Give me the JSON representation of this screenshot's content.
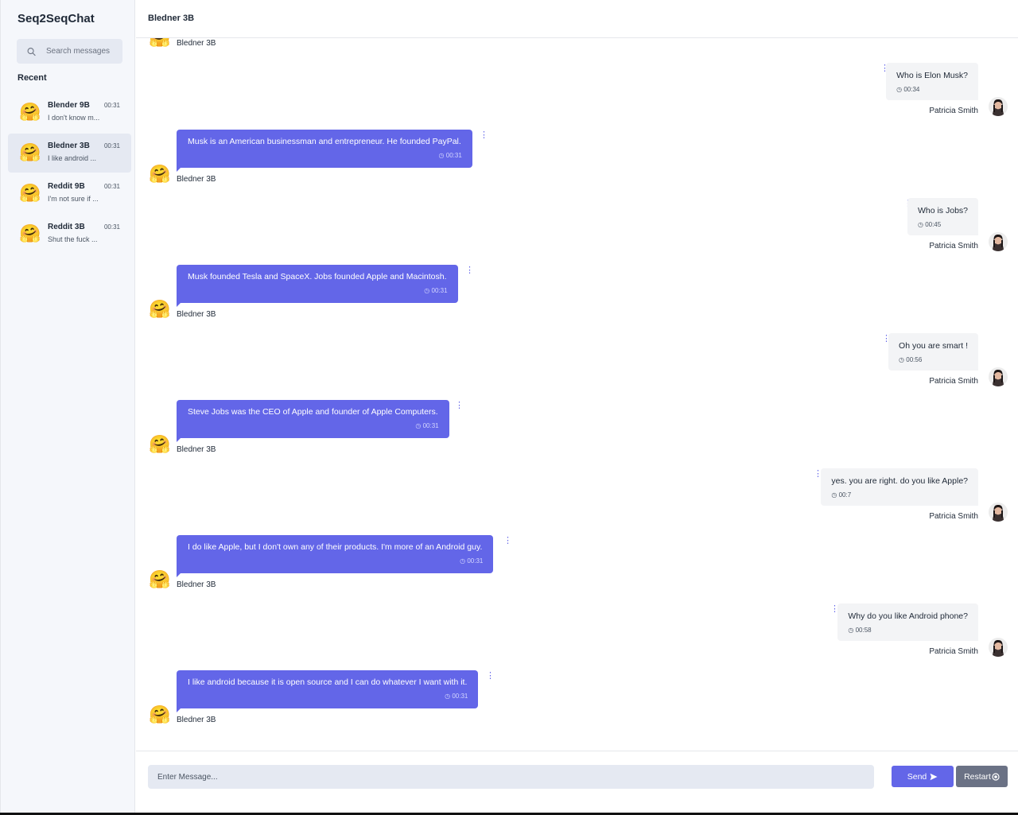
{
  "app": {
    "title": "Seq2SeqChat"
  },
  "search": {
    "placeholder": "Search messages"
  },
  "sidebar": {
    "recent_label": "Recent",
    "contacts": [
      {
        "name": "Blender 9B",
        "time": "00:31",
        "preview": "I don't know m..."
      },
      {
        "name": "Bledner 3B",
        "time": "00:31",
        "preview": "I like android ..."
      },
      {
        "name": "Reddit 9B",
        "time": "00:31",
        "preview": "I'm not sure if ..."
      },
      {
        "name": "Reddit 3B",
        "time": "00:31",
        "preview": "Shut the fuck ..."
      }
    ]
  },
  "chat": {
    "title": "Bledner 3B",
    "top_partial_sender": "Bledner 3B",
    "bot_name": "Bledner 3B",
    "user_name": "Patricia Smith",
    "messages": [
      {
        "from": "user",
        "text": "Who is Elon Musk?",
        "time": "00:34"
      },
      {
        "from": "bot",
        "text": "Musk is an American businessman and entrepreneur. He founded PayPal.",
        "time": "00:31"
      },
      {
        "from": "user",
        "text": "Who is Jobs?",
        "time": "00:45"
      },
      {
        "from": "bot",
        "text": "Musk founded Tesla and SpaceX. Jobs founded Apple and Macintosh.",
        "time": "00:31"
      },
      {
        "from": "user",
        "text": "Oh you are smart !",
        "time": "00:56"
      },
      {
        "from": "bot",
        "text": "Steve Jobs was the CEO of Apple and founder of Apple Computers.",
        "time": "00:31"
      },
      {
        "from": "user",
        "text": "yes. you are right. do you like Apple?",
        "time": "00:7"
      },
      {
        "from": "bot",
        "text": "I do like Apple, but I don't own any of their products. I'm more of an Android guy.",
        "time": "00:31"
      },
      {
        "from": "user",
        "text": "Why do you like Android phone?",
        "time": "00:58"
      },
      {
        "from": "bot",
        "text": "I like android because it is open source and I can do whatever I want with it.",
        "time": "00:31"
      }
    ]
  },
  "composer": {
    "placeholder": "Enter Message...",
    "send_label": "Send",
    "restart_label": "Restart"
  },
  "icons": {
    "bot_avatar": "hugging-face-emoji",
    "user_avatar": "user-photo",
    "send": "paper-plane-icon",
    "restart": "restart-icon",
    "menu": "kebab-menu-icon",
    "clock": "clock-icon"
  },
  "colors": {
    "accent": "#6366e8",
    "restart_button": "#6b7285",
    "sidebar_bg": "#f5f7fb",
    "input_bg": "#e5e9f2"
  }
}
